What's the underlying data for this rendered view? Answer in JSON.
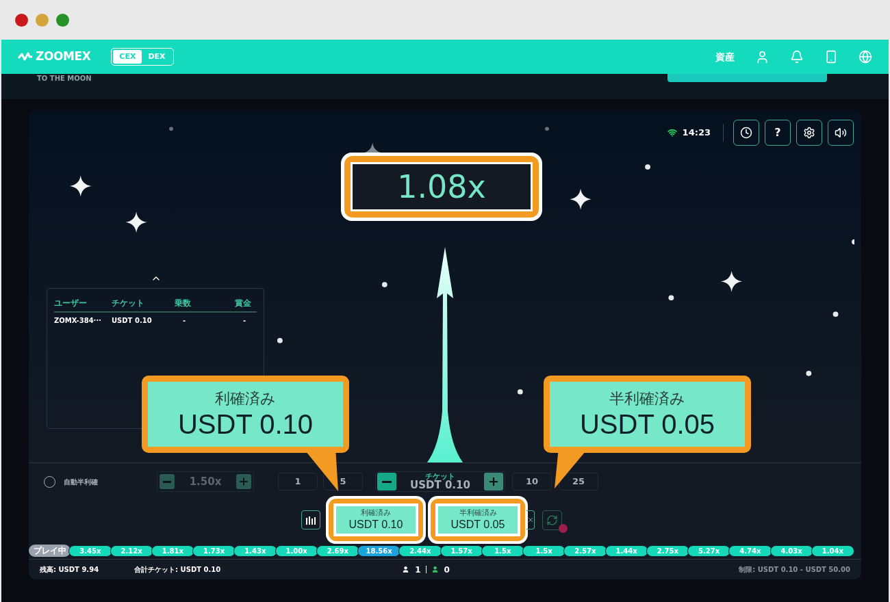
{
  "header": {
    "logo": "ZOOMEX",
    "tabs": [
      {
        "label": "CEX",
        "selected": true
      },
      {
        "label": "DEX",
        "selected": false
      }
    ],
    "assets": "資産"
  },
  "subheader": {
    "tagline": "TO THE MOON"
  },
  "game": {
    "time": "14:23",
    "help": "?",
    "multiplier": "1.08x",
    "leaderboard": {
      "columns": [
        "ユーザー",
        "チケット",
        "乗数",
        "賞金"
      ],
      "rows": [
        [
          "ZOMX-384···",
          "USDT 0.10",
          "-",
          "-"
        ]
      ]
    }
  },
  "controls": {
    "auto_half": {
      "label": "自動半利確",
      "checked": false
    },
    "auto_multiplier": "1.50x",
    "quick_amounts": [
      "1",
      "5",
      "10",
      "25"
    ],
    "ticket": {
      "label": "チケット",
      "value": "USDT 0.10"
    },
    "cashouts": [
      {
        "label": "利確済み",
        "amount": "USDT 0.10"
      },
      {
        "label": "半利確済み",
        "amount": "USDT 0.05"
      }
    ]
  },
  "history": [
    {
      "label": "プレイ中",
      "kind": "live"
    },
    {
      "label": "3.45x",
      "kind": "round",
      "color": "#16d9b9"
    },
    {
      "label": "2.12x",
      "kind": "round",
      "color": "#16d9b9"
    },
    {
      "label": "1.81x",
      "kind": "round",
      "color": "#16d9b9"
    },
    {
      "label": "1.73x",
      "kind": "round",
      "color": "#16d9b9"
    },
    {
      "label": "1.43x",
      "kind": "round",
      "color": "#16d9b9"
    },
    {
      "label": "1.00x",
      "kind": "round",
      "color": "#16d9b9"
    },
    {
      "label": "2.69x",
      "kind": "round",
      "color": "#16d9b9"
    },
    {
      "label": "18.56x",
      "kind": "round",
      "color": "#1ba3dc"
    },
    {
      "label": "2.44x",
      "kind": "round",
      "color": "#16d9b9"
    },
    {
      "label": "1.57x",
      "kind": "round",
      "color": "#16d9b9"
    },
    {
      "label": "1.5x",
      "kind": "round",
      "color": "#16d9b9"
    },
    {
      "label": "1.5x",
      "kind": "round",
      "color": "#16d9b9"
    },
    {
      "label": "2.57x",
      "kind": "round",
      "color": "#16d9b9"
    },
    {
      "label": "1.44x",
      "kind": "round",
      "color": "#16d9b9"
    },
    {
      "label": "2.75x",
      "kind": "round",
      "color": "#16d9b9"
    },
    {
      "label": "5.27x",
      "kind": "round",
      "color": "#16d9b9"
    },
    {
      "label": "4.74x",
      "kind": "round",
      "color": "#16d9b9"
    },
    {
      "label": "4.03x",
      "kind": "round",
      "color": "#16d9b9"
    },
    {
      "label": "1.04x",
      "kind": "round",
      "color": "#16d9b9"
    }
  ],
  "status_bar": {
    "balance_label": "残高:",
    "balance": "USDT 9.94",
    "total_label": "合計チケット:",
    "total": "USDT 0.10",
    "players": "1",
    "winners": "0",
    "limit_label": "制限:",
    "limit": "USDT 0.10 - USDT 50.00"
  },
  "annotations": [
    {
      "label": "利確済み",
      "amount": "USDT 0.10"
    },
    {
      "label": "半利確済み",
      "amount": "USDT 0.05"
    }
  ]
}
